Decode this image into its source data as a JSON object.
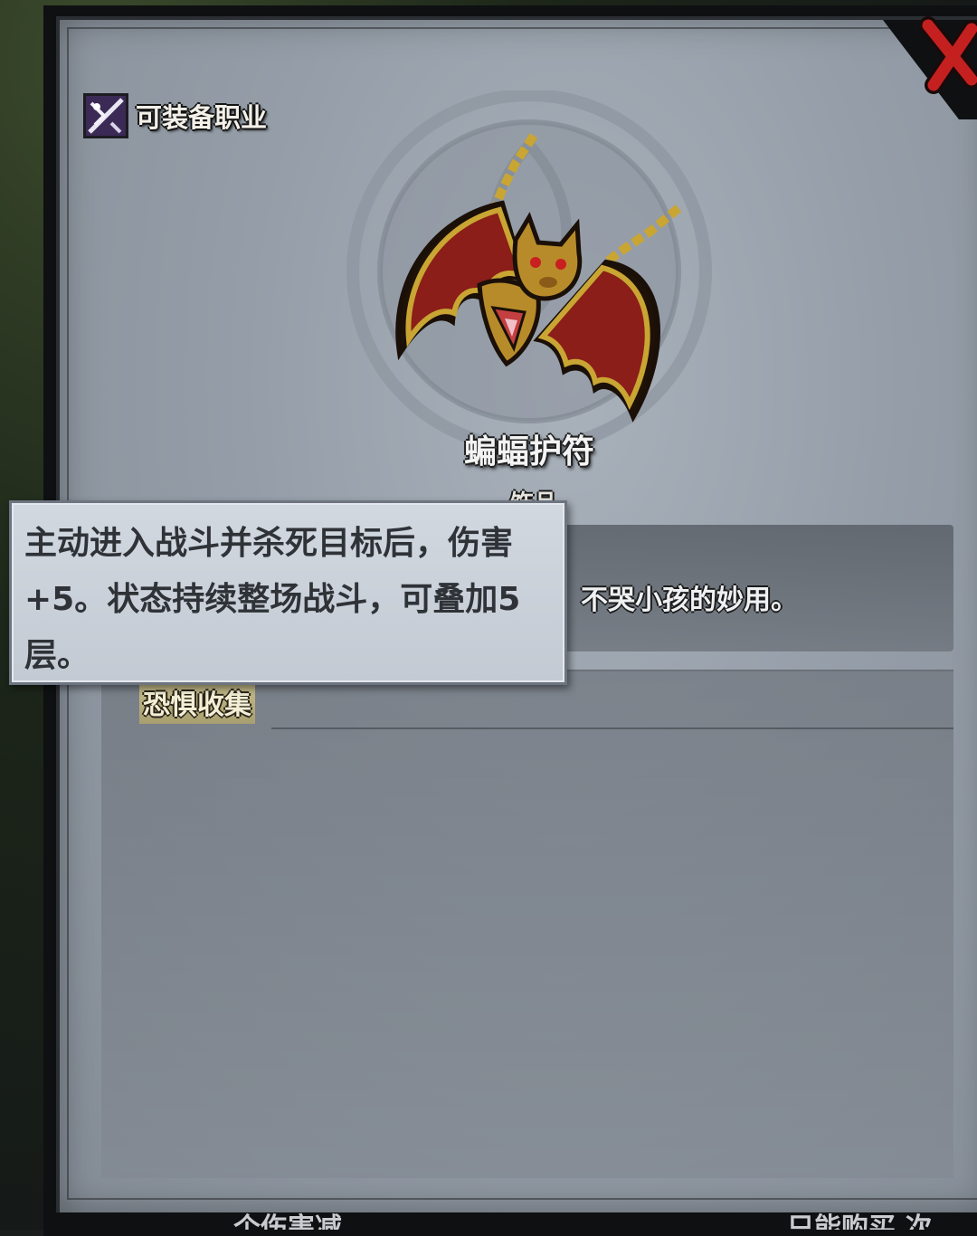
{
  "equip_class": {
    "label": "可装备职业",
    "icon": "class-emblem-icon"
  },
  "item": {
    "name": "蝙蝠护符",
    "type": "饰品",
    "flavor_text": "不哭小孩的妙用。",
    "art": "bat-amulet-icon"
  },
  "effect": {
    "title": "恐惧收集"
  },
  "tooltip": {
    "text": "主动进入战斗并杀死目标后，伤害+5。状态持续整场战斗，可叠加5层。"
  },
  "close_button": {
    "icon": "close-x-icon",
    "color": "#c42020"
  },
  "footer": {
    "left_text": "个伤害减",
    "right_text": "只能购买 次"
  }
}
